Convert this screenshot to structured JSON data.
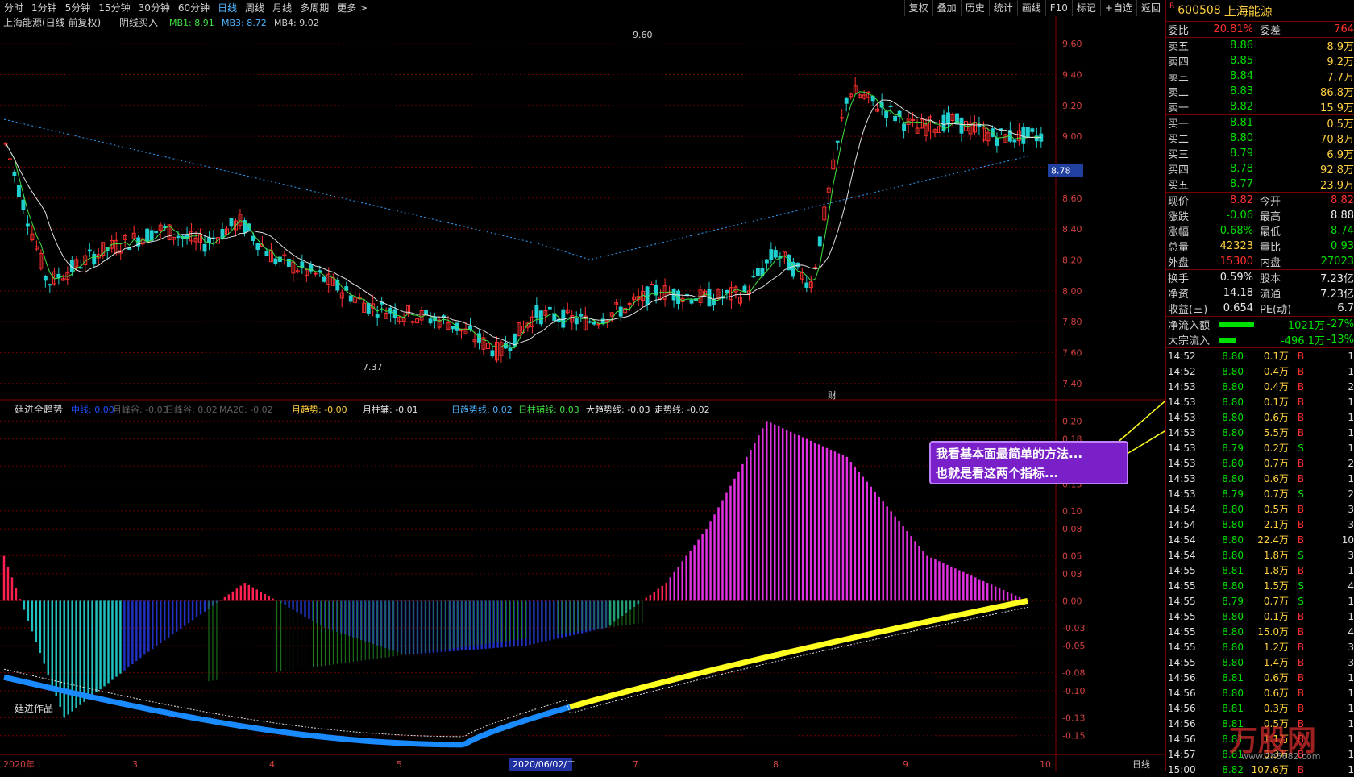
{
  "topbar": {
    "periods": [
      "分时",
      "1分钟",
      "5分钟",
      "15分钟",
      "30分钟",
      "60分钟",
      "日线",
      "周线",
      "月线",
      "多周期",
      "更多 >"
    ],
    "active_period": "日线",
    "right_buttons": [
      "复权",
      "叠加",
      "历史",
      "统计",
      "画线",
      "F10",
      "标记",
      "+自选",
      "返回"
    ]
  },
  "main_chart": {
    "title": "上海能源(日线 前复权)",
    "indicator": "阴线买入",
    "mb1": "MB1: 8.91",
    "mb3": "MB3: 8.72",
    "mb4": "MB4: 9.02",
    "high_label": "9.60",
    "low_label": "7.37",
    "price_marker": "8.78",
    "price_axis": [
      "9.60",
      "9.40",
      "9.20",
      "9.00",
      "8.80",
      "8.60",
      "8.40",
      "8.20",
      "8.00",
      "7.80",
      "7.60",
      "7.40"
    ],
    "event_marker": "财"
  },
  "sub_chart": {
    "name": "廷进全趋势",
    "fields": [
      "中线: 0.00",
      "月峰谷: -0.03",
      "日峰谷: 0.02",
      "MA20: -0.02"
    ],
    "month_trend": "月趋势: -0.00",
    "month_bar": "月柱辅: -0.01",
    "day_trend": "日趋势线: 0.02",
    "day_bar": "日柱辅线: 0.03",
    "big_trend": "大趋势线: -0.03",
    "walk_trend": "走势线: -0.02",
    "axis": [
      "0.20",
      "0.18",
      "0.15",
      "0.13",
      "0.10",
      "0.08",
      "0.05",
      "0.03",
      "0.00",
      "-0.03",
      "-0.05",
      "-0.08",
      "-0.10",
      "-0.13",
      "-0.15"
    ],
    "watermark": "廷进作品"
  },
  "xaxis": {
    "labels": [
      "2020年",
      "3",
      "4",
      "5",
      "6",
      "7",
      "8",
      "9",
      "10"
    ],
    "cursor_date": "2020/06/02/二",
    "period_label": "日线"
  },
  "callout": {
    "line1": "我看基本面最简单的方法...",
    "line2": "也就是看这两个指标..."
  },
  "quote": {
    "tag": "R",
    "code": "600508",
    "name": "上海能源",
    "wei_bi_label": "委比",
    "wei_bi": "20.81%",
    "wei_cha_label": "委差",
    "wei_cha": "764",
    "sells": [
      {
        "label": "卖五",
        "price": "8.86",
        "vol": "8.9万"
      },
      {
        "label": "卖四",
        "price": "8.85",
        "vol": "9.2万"
      },
      {
        "label": "卖三",
        "price": "8.84",
        "vol": "7.7万"
      },
      {
        "label": "卖二",
        "price": "8.83",
        "vol": "86.8万"
      },
      {
        "label": "卖一",
        "price": "8.82",
        "vol": "15.9万"
      }
    ],
    "buys": [
      {
        "label": "买一",
        "price": "8.81",
        "vol": "0.5万"
      },
      {
        "label": "买二",
        "price": "8.80",
        "vol": "70.8万"
      },
      {
        "label": "买三",
        "price": "8.79",
        "vol": "6.9万"
      },
      {
        "label": "买四",
        "price": "8.78",
        "vol": "92.8万"
      },
      {
        "label": "买五",
        "price": "8.77",
        "vol": "23.9万"
      }
    ],
    "stats": [
      {
        "l1": "现价",
        "v1": "8.82",
        "c1": "red",
        "l2": "今开",
        "v2": "8.82",
        "c2": "red"
      },
      {
        "l1": "涨跌",
        "v1": "-0.06",
        "c1": "green",
        "l2": "最高",
        "v2": "8.88",
        "c2": "white"
      },
      {
        "l1": "涨幅",
        "v1": "-0.68%",
        "c1": "green",
        "l2": "最低",
        "v2": "8.74",
        "c2": "green"
      },
      {
        "l1": "总量",
        "v1": "42323",
        "c1": "yellow",
        "l2": "量比",
        "v2": "0.93",
        "c2": "green"
      },
      {
        "l1": "外盘",
        "v1": "15300",
        "c1": "red",
        "l2": "内盘",
        "v2": "27023",
        "c2": "green"
      }
    ],
    "fund": [
      {
        "l1": "换手",
        "v1": "0.59%",
        "l2": "股本",
        "v2": "7.23亿"
      },
      {
        "l1": "净资",
        "v1": "14.18",
        "l2": "流通",
        "v2": "7.23亿"
      },
      {
        "l1": "收益(三)",
        "v1": "0.654",
        "l2": "PE(动)",
        "v2": "6.7"
      }
    ],
    "flows": [
      {
        "label": "净流入额",
        "value": "-1021万",
        "pct": "-27%",
        "bar": 0.27
      },
      {
        "label": "大宗流入",
        "value": "-496.1万",
        "pct": "-13%",
        "bar": 0.13
      }
    ]
  },
  "ticks": [
    {
      "t": "14:52",
      "p": "8.80",
      "v": "0.1万",
      "bs": "B",
      "n": "1"
    },
    {
      "t": "14:52",
      "p": "8.80",
      "v": "0.4万",
      "bs": "B",
      "n": "1"
    },
    {
      "t": "14:53",
      "p": "8.80",
      "v": "0.4万",
      "bs": "B",
      "n": "2"
    },
    {
      "t": "14:53",
      "p": "8.80",
      "v": "0.1万",
      "bs": "B",
      "n": "1"
    },
    {
      "t": "14:53",
      "p": "8.80",
      "v": "0.6万",
      "bs": "B",
      "n": "1"
    },
    {
      "t": "14:53",
      "p": "8.80",
      "v": "5.5万",
      "bs": "B",
      "n": "1"
    },
    {
      "t": "14:53",
      "p": "8.79",
      "v": "0.2万",
      "bs": "S",
      "n": "1"
    },
    {
      "t": "14:53",
      "p": "8.80",
      "v": "0.7万",
      "bs": "B",
      "n": "2"
    },
    {
      "t": "14:53",
      "p": "8.80",
      "v": "0.6万",
      "bs": "B",
      "n": "1"
    },
    {
      "t": "14:53",
      "p": "8.79",
      "v": "0.7万",
      "bs": "S",
      "n": "2"
    },
    {
      "t": "14:54",
      "p": "8.80",
      "v": "0.5万",
      "bs": "B",
      "n": "3"
    },
    {
      "t": "14:54",
      "p": "8.80",
      "v": "2.1万",
      "bs": "B",
      "n": "3"
    },
    {
      "t": "14:54",
      "p": "8.80",
      "v": "22.4万",
      "bs": "B",
      "n": "10"
    },
    {
      "t": "14:54",
      "p": "8.80",
      "v": "1.8万",
      "bs": "S",
      "n": "3"
    },
    {
      "t": "14:55",
      "p": "8.81",
      "v": "1.8万",
      "bs": "B",
      "n": "1"
    },
    {
      "t": "14:55",
      "p": "8.80",
      "v": "1.5万",
      "bs": "S",
      "n": "4"
    },
    {
      "t": "14:55",
      "p": "8.79",
      "v": "0.7万",
      "bs": "S",
      "n": "1"
    },
    {
      "t": "14:55",
      "p": "8.80",
      "v": "0.1万",
      "bs": "B",
      "n": "1"
    },
    {
      "t": "14:55",
      "p": "8.80",
      "v": "15.0万",
      "bs": "B",
      "n": "4"
    },
    {
      "t": "14:55",
      "p": "8.80",
      "v": "1.2万",
      "bs": "B",
      "n": "3"
    },
    {
      "t": "14:55",
      "p": "8.80",
      "v": "1.4万",
      "bs": "B",
      "n": "3"
    },
    {
      "t": "14:56",
      "p": "8.81",
      "v": "0.6万",
      "bs": "B",
      "n": "1"
    },
    {
      "t": "14:56",
      "p": "8.80",
      "v": "0.6万",
      "bs": "B",
      "n": "1"
    },
    {
      "t": "14:56",
      "p": "8.81",
      "v": "0.3万",
      "bs": "B",
      "n": "1"
    },
    {
      "t": "14:56",
      "p": "8.81",
      "v": "0.5万",
      "bs": "B",
      "n": "1"
    },
    {
      "t": "14:56",
      "p": "8.81",
      "v": "1.1万",
      "bs": "B",
      "n": "1"
    },
    {
      "t": "14:57",
      "p": "8.81",
      "v": "0.3万",
      "bs": "B",
      "n": "1"
    },
    {
      "t": "15:00",
      "p": "8.82",
      "v": "107.6万",
      "bs": "B",
      "n": "1"
    }
  ],
  "watermark": {
    "logo": "万股网",
    "url": "www.2h5682.com"
  }
}
